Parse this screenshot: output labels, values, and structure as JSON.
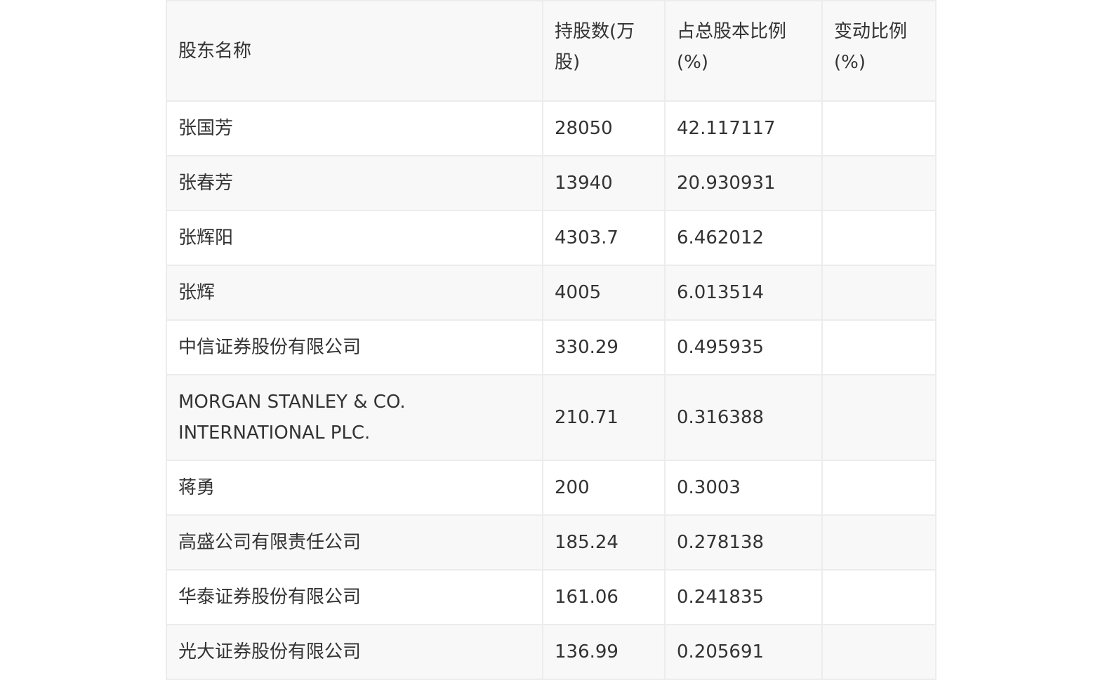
{
  "table": {
    "headers": [
      "股东名称",
      "持股数(万股)",
      "占总股本比例(%)",
      "变动比例(%)"
    ],
    "rows": [
      [
        "张国芳",
        "28050",
        "42.117117",
        ""
      ],
      [
        "张春芳",
        "13940",
        "20.930931",
        ""
      ],
      [
        "张辉阳",
        "4303.7",
        "6.462012",
        ""
      ],
      [
        "张辉",
        "4005",
        "6.013514",
        ""
      ],
      [
        "中信证券股份有限公司",
        "330.29",
        "0.495935",
        ""
      ],
      [
        "MORGAN STANLEY & CO. INTERNATIONAL PLC.",
        "210.71",
        "0.316388",
        ""
      ],
      [
        "蒋勇",
        "200",
        "0.3003",
        ""
      ],
      [
        "高盛公司有限责任公司",
        "185.24",
        "0.278138",
        ""
      ],
      [
        "华泰证券股份有限公司",
        "161.06",
        "0.241835",
        ""
      ],
      [
        "光大证券股份有限公司",
        "136.99",
        "0.205691",
        ""
      ]
    ]
  }
}
